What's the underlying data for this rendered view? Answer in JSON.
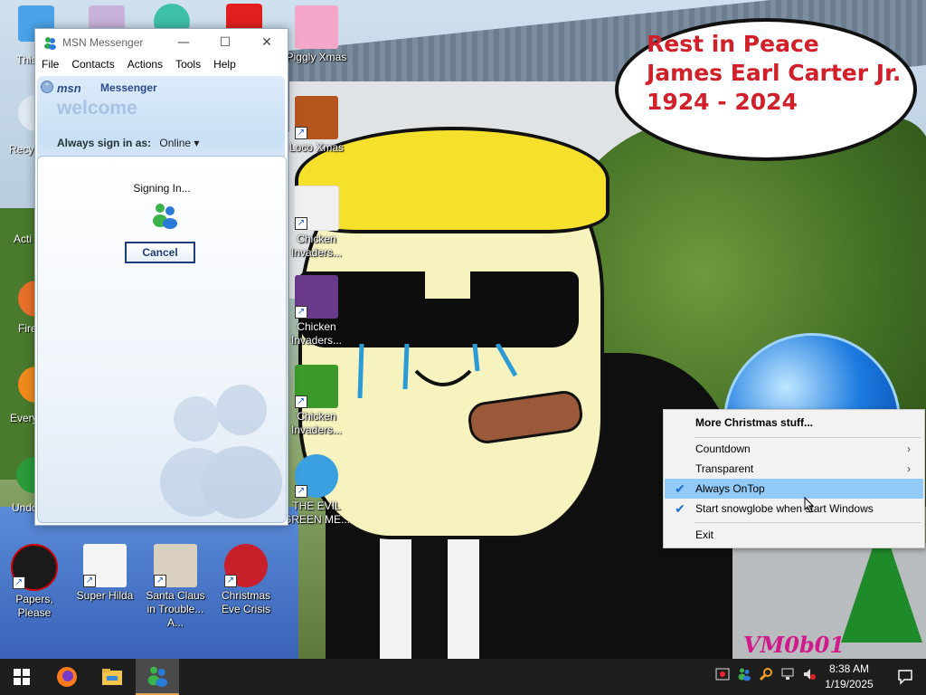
{
  "wallpaper": {
    "bubble_line1": "Rest in Peace",
    "bubble_line2": "James Earl Carter Jr.",
    "bubble_line3": "1924 - 2024",
    "bubble_color": "#d1202a",
    "watermark": "VM0b01"
  },
  "desktop_icons": {
    "col_left": [
      {
        "label": "This"
      },
      {
        "label": "Recyc"
      },
      {
        "label": "Acti"
      },
      {
        "label": "Fire"
      },
      {
        "label": "Every"
      },
      {
        "label": "Undo"
      }
    ],
    "col_games": [
      {
        "label": "Piggly Xmas"
      },
      {
        "label": "Loco Xmas"
      },
      {
        "label": "Chicken Invaders..."
      },
      {
        "label": "Chicken Invaders..."
      },
      {
        "label": "Chicken Invaders..."
      },
      {
        "label": "THE EVIL GREEN ME..."
      }
    ],
    "row_bottom": [
      {
        "label": "Papers, Please"
      },
      {
        "label": "Super Hilda"
      },
      {
        "label": "Santa Claus in Trouble... A..."
      },
      {
        "label": "Christmas Eve Crisis"
      }
    ]
  },
  "msn": {
    "title": "MSN Messenger",
    "menu": [
      "File",
      "Contacts",
      "Actions",
      "Tools",
      "Help"
    ],
    "logo": "msn",
    "logo_sub": "Messenger",
    "welcome": "welcome",
    "signin_label": "Always sign in as:",
    "status": "Online ▾",
    "signing": "Signing In...",
    "cancel": "Cancel",
    "minimize_icon": "minimize-icon",
    "maximize_icon": "maximize-icon",
    "close_icon": "close-icon"
  },
  "context_menu": {
    "items": [
      {
        "label": "More Christmas stuff...",
        "bold": true
      },
      {
        "label": "Countdown",
        "submenu": true
      },
      {
        "label": "Transparent",
        "submenu": true
      },
      {
        "label": "Always OnTop",
        "checked": true,
        "highlighted": true
      },
      {
        "label": "Start snowglobe when start Windows",
        "checked": true
      },
      {
        "label": "Exit"
      }
    ],
    "highlight_color": "#91c9f7"
  },
  "taskbar": {
    "time": "8:38 AM",
    "date": "1/19/2025",
    "apps": [
      "windows-start-icon",
      "firefox-icon",
      "file-explorer-icon",
      "msn-messenger-icon"
    ],
    "tray": [
      "security-icon",
      "msn-tray-icon",
      "search-tray-icon",
      "network-icon",
      "volume-muted-icon"
    ]
  }
}
